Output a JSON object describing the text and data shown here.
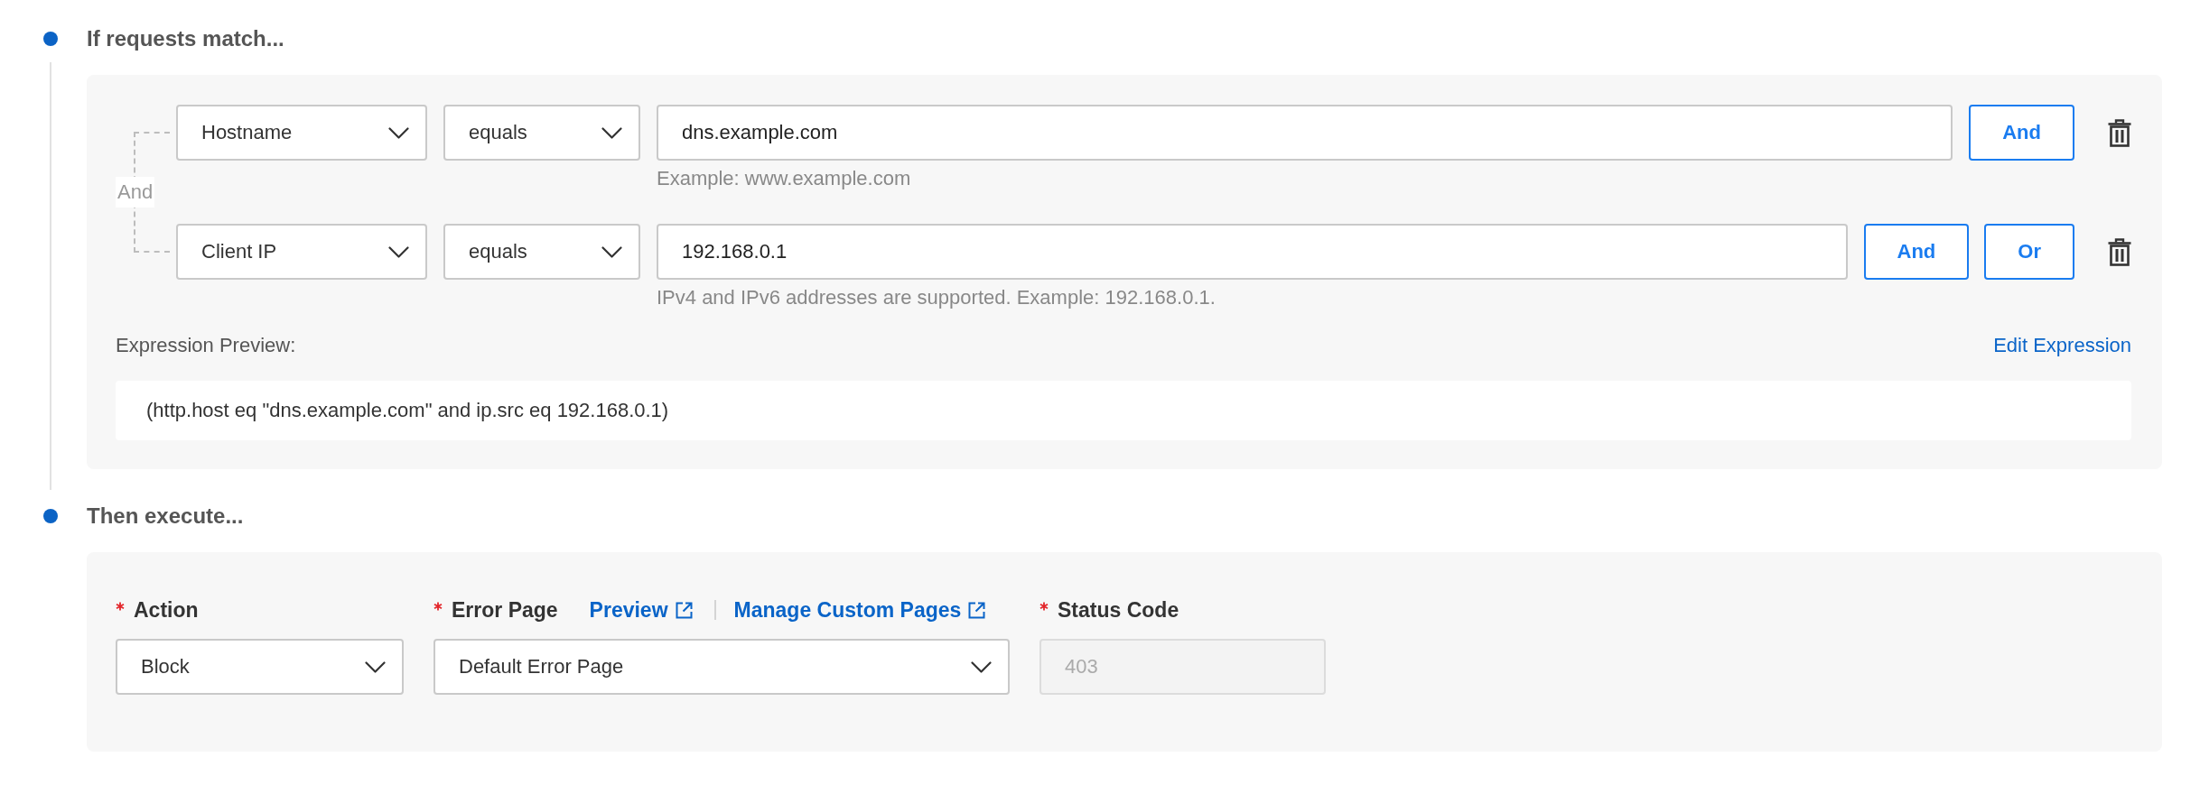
{
  "steps": [
    {
      "kind": "match",
      "title": "If requests match...",
      "connector": "And",
      "conditions": [
        {
          "field": "Hostname",
          "operator": "equals",
          "value": "dns.example.com",
          "hint": "Example: www.example.com",
          "buttons": [
            "And"
          ]
        },
        {
          "field": "Client IP",
          "operator": "equals",
          "value": "192.168.0.1",
          "hint": "IPv4 and IPv6 addresses are supported. Example: 192.168.0.1.",
          "buttons": [
            "And",
            "Or"
          ]
        }
      ],
      "preview_label": "Expression Preview:",
      "edit_link": "Edit Expression",
      "expression": "(http.host eq \"dns.example.com\" and ip.src eq 192.168.0.1)"
    },
    {
      "kind": "execute",
      "title": "Then execute...",
      "fields": [
        {
          "kind": "select",
          "label": "Action",
          "required": true,
          "disabled": false,
          "value": "Block"
        },
        {
          "kind": "select",
          "label": "Error Page",
          "required": true,
          "disabled": false,
          "value": "Default Error Page",
          "links": [
            "Preview",
            "Manage Custom Pages"
          ]
        },
        {
          "kind": "input",
          "label": "Status Code",
          "required": true,
          "disabled": true,
          "value": "403"
        }
      ]
    }
  ]
}
